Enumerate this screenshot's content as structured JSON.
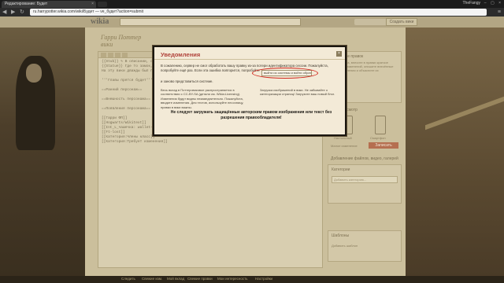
{
  "browser": {
    "tab_title": "Редактирование: Будет",
    "tab_close": "×",
    "user": "TheFangy",
    "window_controls": "–  ▢  ×",
    "url": "ru.harrypotter.wikia.com/wiki/Будет — ve_будет?action=submit",
    "nav_back": "◀",
    "nav_forward": "▶",
    "nav_reload": "↻",
    "menu_icon": "≡"
  },
  "wiki": {
    "logo": "wikia",
    "site_logo": "Гарри Поттер вики",
    "header_button": "Создать вики"
  },
  "editor": {
    "code_lines": [
      "{{Stub}} ✎ В описании, сервер не смог",
      "{{Statue}} Где то замок, в и",
      "На эту вики дважды был проведён",
      "",
      "'''Главы прятся будет''' - это",
      "",
      "==Ранний персонаж==",
      "",
      "==Внешность персонажа==",
      "",
      "==Появления персонажа==",
      "",
      "[[Гарри ФП]]",
      "[[Hogwarts/Wikitext]]",
      "[[Int_L_чашечка: wallet-для_Blabla{file}]]",
      "[[Ft-lost]]",
      "[[Категория:Члены класс]]",
      "[[Категория:Требует изменения]]"
    ]
  },
  "rail": {
    "summary_title": "Описание правок",
    "summary_text": "Пожалуйста, внесите в правки краткое описание изменений, опишите внесённые вами изменения и объясните их",
    "preview_title": "Предпросмотр",
    "desktop_label": "Настольный",
    "mobile_label": "Смартфон",
    "minor_label": "Малое изменение",
    "publish_label": "Записать",
    "add_link": "Добавление файлов, видео, галерей",
    "categories_title": "Категории",
    "categories_placeholder": "Добавить категорию...",
    "templates_title": "Шаблоны",
    "templates_text": "Добавить шаблон"
  },
  "modal": {
    "title": "Уведомления",
    "close_icon": "×",
    "message": "В сожалению, сервер не смог обработать вашу правку из-за потери идентификатора сессии. Пожалуйста, попробуйте ещё раз. Если эта ошибка повторится, попробуйте",
    "captcha_text": "выйти из системы и войти обратно",
    "message_tail": "и заново представиться системе.",
    "info_left": "Весь вклад в Поттеровиковое распространяется в соответствии с CC-BY-SA (детали см. Wikia:Licensing). Изменения будут видны незамедлительно. Пожалуйста, вводите изменения. Для тестов, используйте песочницу, правки в вики важны.",
    "info_right": "Загрузка изображений в вики. Не забывайте о категоризации страниц! Загрузите ваш новый блог.",
    "warning": "Не следует загружать защищённые авторским правом изображения или текст без разрешения правообладателя!"
  },
  "footer": {
    "links": [
      "Следить",
      "Свежие изм.",
      "Мой вклад",
      "Свежие правки",
      "Мои интересность",
      "Настройки"
    ]
  }
}
